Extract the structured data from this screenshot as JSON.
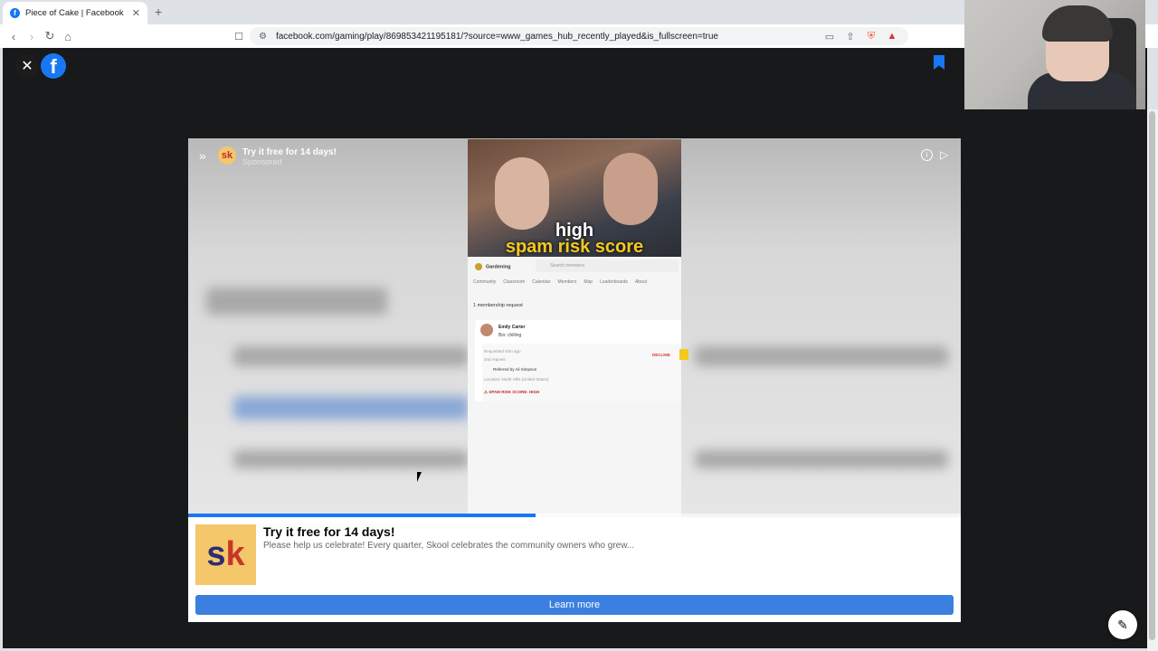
{
  "browser": {
    "tab_title": "Piece of Cake | Facebook",
    "tab_close": "✕",
    "new_tab": "+",
    "url": "facebook.com/gaming/play/869853421195181/?source=www_games_hub_recently_played&is_fullscreen=true"
  },
  "ad": {
    "header_title": "Try it free for 14 days!",
    "header_subtitle": "Sponsored",
    "brand_initials": "sk",
    "title": "Try it free for 14 days!",
    "description": "Please help us celebrate! Every quarter, Skool celebrates the community owners who grew...",
    "cta": "Learn more",
    "progress_fraction": 0.45
  },
  "video": {
    "headline_1": "high",
    "headline_2": "spam risk score",
    "group_name": "Gardening",
    "search_placeholder": "Search members",
    "nav": [
      "Community",
      "Classroom",
      "Calendar",
      "Members",
      "Map",
      "Leaderboards",
      "About"
    ],
    "request_count": "1 membership request",
    "member_name": "Emily Carter",
    "member_bio": "Bio: chilling",
    "requested": "Requested 44m ago",
    "request_num": "2nd request",
    "referred_by": "Referred by Ali Simpson",
    "location": "Location: North Hills (United States)",
    "spam_score": "⚠ SPAM RISK SCORE: HIGH",
    "decline": "DECLINE"
  },
  "colors": {
    "facebook_blue": "#1877f2",
    "cta_blue": "#3b80e0",
    "skool_yellow": "#f4c76a"
  }
}
